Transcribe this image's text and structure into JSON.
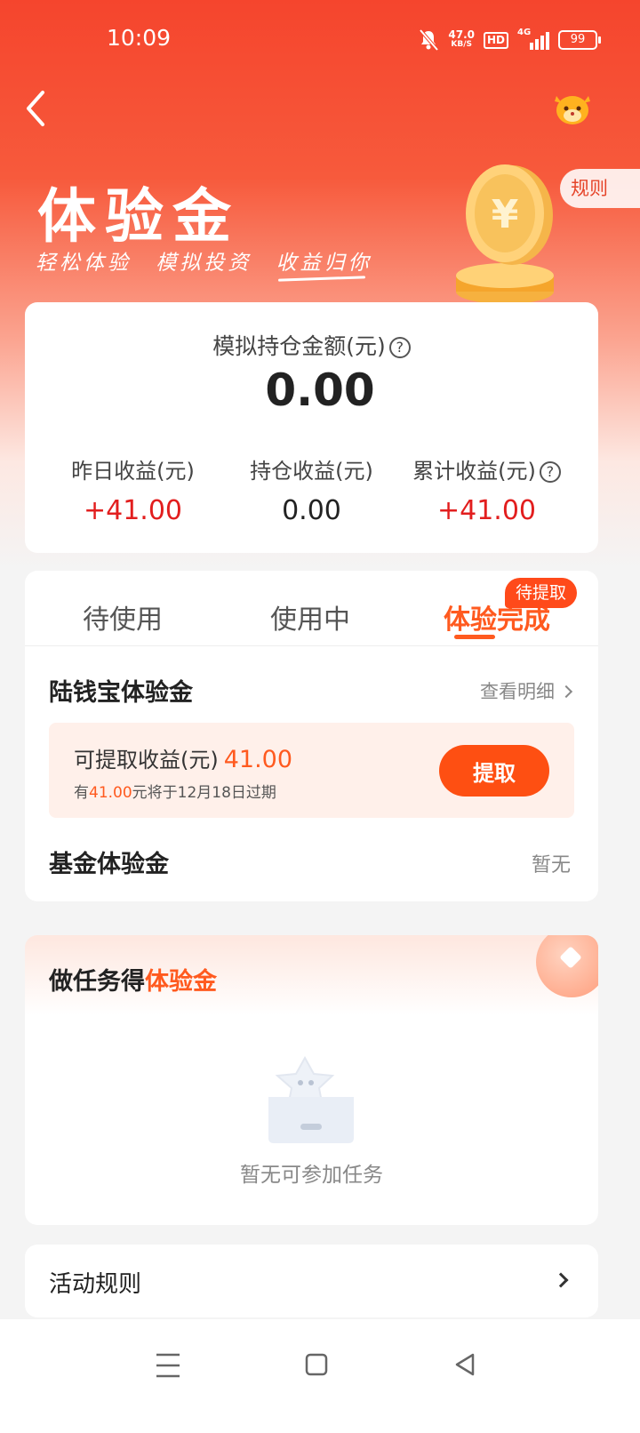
{
  "status_bar": {
    "time": "10:09",
    "net_speed": "47.0",
    "net_unit": "KB/S",
    "hd": "HD",
    "network": "4G",
    "battery": "99"
  },
  "header": {
    "rules_label": "规则",
    "title": "体验金",
    "subtitle": [
      "轻松体验",
      "模拟投资",
      "收益归你"
    ]
  },
  "holding": {
    "label": "模拟持仓金额(元)",
    "help": "?",
    "value": "0.00",
    "stats": [
      {
        "label": "昨日收益(元)",
        "value": "+41.00"
      },
      {
        "label": "持仓收益(元)",
        "value": "0.00"
      },
      {
        "label": "累计收益(元)",
        "value": "+41.00"
      }
    ]
  },
  "tabs": {
    "items": [
      "待使用",
      "使用中",
      "体验完成"
    ],
    "active_index": 2,
    "badge": "待提取"
  },
  "lu_section": {
    "title": "陆钱宝体验金",
    "view_detail": "查看明细",
    "withdraw_label": "可提取收益(元)",
    "withdraw_amount": "41.00",
    "expire_prefix": "有",
    "expire_amount": "41.00",
    "expire_suffix": "元将于12月18日过期",
    "withdraw_button": "提取"
  },
  "fund_section": {
    "title": "基金体验金",
    "status": "暂无"
  },
  "tasks": {
    "title_prefix": "做任务得",
    "title_highlight": "体验金",
    "empty_text": "暂无可参加任务"
  },
  "rules_row": {
    "label": "活动规则"
  },
  "colors": {
    "brand": "#f5452d",
    "accent": "#ff5a1f",
    "gain": "#e21e1e"
  },
  "icons": [
    "back-icon",
    "mascot-icon",
    "coin-icon",
    "help-icon",
    "chevron-right-icon",
    "empty-box-icon",
    "menu-icon",
    "home-icon",
    "nav-back-icon"
  ]
}
